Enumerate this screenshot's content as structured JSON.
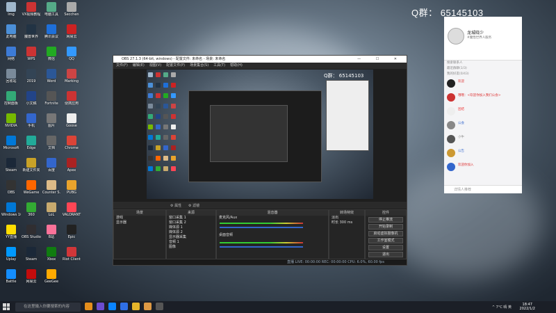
{
  "desktop": {
    "group_label": "Q群：  65145103",
    "icons": [
      {
        "label": "Img",
        "color": "#9fb7cc"
      },
      {
        "label": "VX视频教程",
        "color": "#c33"
      },
      {
        "label": "电脑工具",
        "color": "#5a8"
      },
      {
        "label": "Secchen",
        "color": "#aaa"
      },
      {
        "label": "此电脑",
        "color": "#4b8fd8"
      },
      {
        "label": "魔兽世界",
        "color": "#234"
      },
      {
        "label": "腾讯会议",
        "color": "#1e6fd9"
      },
      {
        "label": "网易云",
        "color": "#c22"
      },
      {
        "label": "网络",
        "color": "#3d7bd6"
      },
      {
        "label": "WPS",
        "color": "#c33"
      },
      {
        "label": "微信",
        "color": "#2a2"
      },
      {
        "label": "QQ",
        "color": "#39f"
      },
      {
        "label": "回收站",
        "color": "#7a8a9a"
      },
      {
        "label": "2019",
        "color": "#345"
      },
      {
        "label": "Word",
        "color": "#2b5797"
      },
      {
        "label": "Marking",
        "color": "#c44"
      },
      {
        "label": "控制面板",
        "color": "#3a7"
      },
      {
        "label": "小文稿",
        "color": "#248"
      },
      {
        "label": "Fortnite",
        "color": "#555"
      },
      {
        "label": "便携应用",
        "color": "#c33"
      },
      {
        "label": "NVIDIA",
        "color": "#76b900"
      },
      {
        "label": "手机",
        "color": "#36c"
      },
      {
        "label": "图片",
        "color": "#777"
      },
      {
        "label": "Goose",
        "color": "#eee"
      },
      {
        "label": "Microsoft",
        "color": "#0078d7"
      },
      {
        "label": "Edge",
        "color": "#2a9"
      },
      {
        "label": "文档",
        "color": "#666"
      },
      {
        "label": "Chrome",
        "color": "#db4437"
      },
      {
        "label": "Steam",
        "color": "#1b2838"
      },
      {
        "label": "新建文件夹",
        "color": "#c9a227"
      },
      {
        "label": "百度",
        "color": "#36c"
      },
      {
        "label": "Apex",
        "color": "#a22"
      },
      {
        "label": "OBS",
        "color": "#333"
      },
      {
        "label": "WeGame",
        "color": "#f60"
      },
      {
        "label": "Counter S.",
        "color": "#db8"
      },
      {
        "label": "PUBG",
        "color": "#e9a32c"
      },
      {
        "label": "Windows 10",
        "color": "#0078d7"
      },
      {
        "label": "360",
        "color": "#3a3"
      },
      {
        "label": "LoL",
        "color": "#c8aa6e"
      },
      {
        "label": "VALORANT",
        "color": "#ff4655"
      },
      {
        "label": "YY直播",
        "color": "#fd0"
      },
      {
        "label": "OBS Studio",
        "color": "#302e31"
      },
      {
        "label": "B站",
        "color": "#fb7299"
      },
      {
        "label": "Epic",
        "color": "#222"
      },
      {
        "label": "Uplay",
        "color": "#09f"
      },
      {
        "label": "Steam",
        "color": "#1b2838"
      },
      {
        "label": "Xbox",
        "color": "#107c10"
      },
      {
        "label": "Riot Client",
        "color": "#d13639"
      },
      {
        "label": "Battle",
        "color": "#148eff"
      },
      {
        "label": "网易云",
        "color": "#c20c0c"
      },
      {
        "label": "GeeGee",
        "color": "#fa0"
      }
    ]
  },
  "obs": {
    "title": "OBS 27.1.3 (64-bit, windows) - 配置文件: 未命名 - 场景: 未命名",
    "window_buttons": "— ☐ ✕",
    "menu": [
      "文件(F)",
      "编辑(E)",
      "视图(V)",
      "配置文件(P)",
      "场景集合(S)",
      "工具(T)",
      "帮助(H)"
    ],
    "preview_label": "Q群：  65145103",
    "filter_bar": [
      "⚙ 属性",
      "⚙ 滤镜"
    ],
    "docks": {
      "scenes": {
        "header": "场景",
        "items": [
          "游戏",
          "显示器"
        ]
      },
      "sources": {
        "header": "来源",
        "items": [
          "窗口采集 1",
          "窗口采集 2",
          "媒体源 1",
          "媒体源 2",
          "显示器采集",
          "音频 1",
          "图像"
        ]
      },
      "mixer": {
        "header": "混音器",
        "channels": [
          {
            "name": "麦克风/Aux",
            "db": "0.0 dB"
          },
          {
            "name": "桌面音频",
            "db": "0.0 dB"
          }
        ]
      },
      "transitions": {
        "header": "转场特效",
        "type": "淡出",
        "duration_label": "时长",
        "duration": "300 ms"
      },
      "controls": {
        "header": "控件",
        "buttons": [
          "停止推流",
          "开始录制",
          "启动虚拟摄像机",
          "工作室模式",
          "设置",
          "退出"
        ]
      }
    },
    "status": "直播 LIVE: 00:00:00    REC: 00:00:00    CPU: 6.0%, 60.00 fps"
  },
  "qq": {
    "name": "龙城晓少",
    "signature": "#魔性世界人服务",
    "search": "搜索联系人",
    "tabs": [
      "最近群聊(1/3)",
      "我的好友(0/43)"
    ],
    "messages": [
      {
        "text": "欢迎",
        "color": "#d33"
      },
      {
        "text": "哦哦：<欢迎你加入我们公会>",
        "color": "#d33"
      },
      {
        "text": "团结",
        "color": "#e33"
      },
      {
        "text": "公会",
        "color": "#36c"
      },
      {
        "text": "小牛",
        "color": "#888"
      },
      {
        "text": "公告",
        "color": "#36c"
      },
      {
        "text": "欢迎你加入",
        "color": "#d33"
      }
    ],
    "input_placeholder": "详情人推荐"
  },
  "taskbar": {
    "search_placeholder": "在这里输入你要搜索的内容",
    "apps": [
      "#e48d1c",
      "#6b4ccf",
      "#0a84ff",
      "#2f6fe6",
      "#e6b52a",
      "#d94",
      "#555"
    ],
    "tray": "^ 7°C 晴  英",
    "time": "18:47",
    "date": "2022/1/2"
  }
}
